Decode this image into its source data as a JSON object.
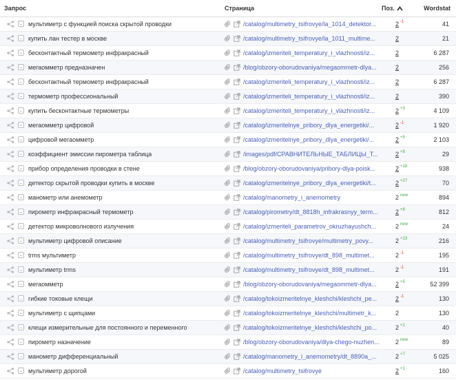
{
  "columns": {
    "query": "Запрос",
    "page": "Страница",
    "position": "Поз.",
    "wordstat": "Wordstat"
  },
  "rows": [
    {
      "query": "мультиметр с функцией поиска скрытой проводки",
      "page": "/catalog/multimetry_tsifrovye/la_1014_detektor...",
      "position": "2",
      "delta": "-1",
      "dir": "down",
      "wordstat": "41"
    },
    {
      "query": "купить лан тестер в москве",
      "page": "/catalog/multimetry_tsifrovye/la_1011_multime...",
      "position": "2",
      "delta": "",
      "dir": "",
      "wordstat": "21"
    },
    {
      "query": "бесконтактный термометр инфракрасный",
      "page": "/catalog/izmeriteli_temperatury_i_vlazhnosti/iz...",
      "position": "2",
      "delta": "",
      "dir": "",
      "wordstat": "6 287"
    },
    {
      "query": "мегаомметр предназначен",
      "page": "/blog/obzory-oborudovaniya/megaommetr-dlya...",
      "position": "2",
      "delta": "",
      "dir": "",
      "wordstat": "256"
    },
    {
      "query": "бесконтактный термометр инфракрасный",
      "page": "/catalog/izmeriteli_temperatury_i_vlazhnosti/iz...",
      "position": "2",
      "delta": "",
      "dir": "",
      "wordstat": "6 287"
    },
    {
      "query": "термометр профессиональный",
      "page": "/catalog/izmeriteli_temperatury_i_vlazhnosti/iz...",
      "position": "2",
      "delta": "",
      "dir": "",
      "wordstat": "390"
    },
    {
      "query": "купить бесконтактные термометры",
      "page": "/catalog/izmeriteli_temperatury_i_vlazhnosti/iz...",
      "position": "2",
      "delta": "+3",
      "dir": "up",
      "wordstat": "4 109"
    },
    {
      "query": "мегаомметр цифровой",
      "page": "/catalog/izmeritelnye_pribory_dlya_energetiki/...",
      "position": "2",
      "delta": "-1",
      "dir": "down",
      "wordstat": "1 920"
    },
    {
      "query": "цифровой мегаомметр",
      "page": "/catalog/izmeritelnye_pribory_dlya_energetiki/...",
      "position": "2",
      "delta": "+5",
      "dir": "up",
      "wordstat": "2 103"
    },
    {
      "query": "коэффициент эмиссии пирометра таблица",
      "page": "/images/pdf/СРАВНИТЕЛЬНЫЕ_ТАБЛИЦЫ_Т...",
      "position": "2",
      "delta": "+8",
      "dir": "up",
      "wordstat": "29"
    },
    {
      "query": "прибор определения проводки в стене",
      "page": "/blog/obzory-oborudovaniya/pribory-dlya-poisk...",
      "position": "2",
      "delta": "+18",
      "dir": "up",
      "wordstat": "938"
    },
    {
      "query": "детектор скрытой проводки купить в москве",
      "page": "/catalog/izmeritelnye_pribory_dlya_energetiki/t...",
      "position": "2",
      "delta": "+27",
      "dir": "up",
      "wordstat": "70"
    },
    {
      "query": "манометр или анемометр",
      "page": "/catalog/manometry_i_anemometry",
      "position": "2",
      "delta": "new",
      "dir": "up",
      "wordstat": "894"
    },
    {
      "query": "пирометр инфракрасный термометр",
      "page": "/catalog/pirometry/dt_8818h_infrakrasnyy_term...",
      "position": "2",
      "delta": "+8",
      "dir": "up",
      "wordstat": "812"
    },
    {
      "query": "детектор микроволнового излучения",
      "page": "/catalog/izmeriteli_parametrov_okruzhayushch...",
      "position": "2",
      "delta": "new",
      "dir": "up",
      "wordstat": "24"
    },
    {
      "query": "мультиметр цифровой описание",
      "page": "/catalog/multimetry_tsifrovye/multimetry_povy...",
      "position": "2",
      "delta": "+13",
      "dir": "up",
      "wordstat": "216"
    },
    {
      "query": "trms мультиметр",
      "page": "/catalog/multimetry_tsifrovye/dt_898_multimet...",
      "position": "2",
      "delta": "-1",
      "dir": "down",
      "wordstat": "195"
    },
    {
      "query": "мультиметр trms",
      "page": "/catalog/multimetry_tsifrovye/dt_898_multimet...",
      "position": "2",
      "delta": "-1",
      "dir": "down",
      "wordstat": "191"
    },
    {
      "query": "мегаомметр",
      "page": "/blog/obzory-oborudovaniya/megaommetr-dlya...",
      "position": "2",
      "delta": "+5",
      "dir": "up",
      "wordstat": "52 399"
    },
    {
      "query": "гибкие токовые клещи",
      "page": "/catalog/tokoizmeritelnye_kleshchi/kleshchi_pe...",
      "position": "2",
      "delta": "-1",
      "dir": "down",
      "wordstat": "130"
    },
    {
      "query": "мультиметр с щипцами",
      "page": "/catalog/tokoizmeritelnye_kleshchi/multimetr_k...",
      "position": "2",
      "delta": "",
      "dir": "",
      "wordstat": "130"
    },
    {
      "query": "клещи измерительные для постоянного и переменного",
      "page": "/catalog/tokoizmeritelnye_kleshchi/kleshchi_po...",
      "position": "2",
      "delta": "+1",
      "dir": "up",
      "wordstat": "40"
    },
    {
      "query": "пирометр назначение",
      "page": "/blog/obzory-oborudovaniya/dlya-chego-nuzhen...",
      "position": "2",
      "delta": "new",
      "dir": "up",
      "wordstat": "89"
    },
    {
      "query": "манометр дифференциальный",
      "page": "/catalog/manometry_i_anemometry/dt_8890a_...",
      "position": "2",
      "delta": "+7",
      "dir": "up",
      "wordstat": "5 025"
    },
    {
      "query": "мультиметр дорогой",
      "page": "/catalog/multimetry_tsifrovye",
      "position": "2",
      "delta": "+1",
      "dir": "up",
      "wordstat": "160"
    }
  ]
}
